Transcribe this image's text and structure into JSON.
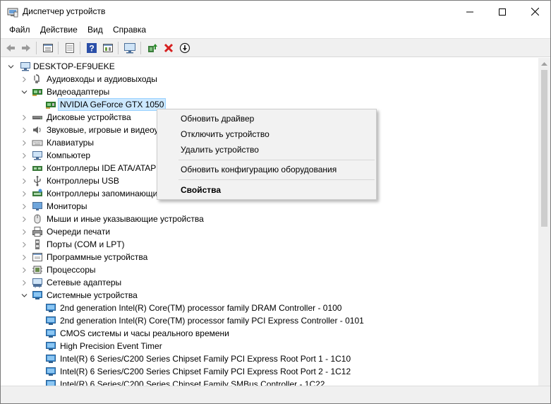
{
  "window": {
    "title": "Диспетчер устройств"
  },
  "menubar": [
    "Файл",
    "Действие",
    "Вид",
    "Справка"
  ],
  "toolbar": {
    "icons": [
      "back-icon",
      "forward-icon",
      "properties-icon",
      "tree-view-icon",
      "help-icon",
      "action-view-icon",
      "monitor-icon",
      "update-driver-icon",
      "remove-icon",
      "download-icon"
    ]
  },
  "tree": {
    "root": "DESKTOP-EF9UEKE",
    "items": [
      {
        "label": "Аудиовходы и аудиовыходы",
        "icon": "audio-io-icon",
        "state": "collapsed"
      },
      {
        "label": "Видеоадаптеры",
        "icon": "display-adapter-icon",
        "state": "expanded"
      },
      {
        "label": "NVIDIA GeForce GTX 1050",
        "icon": "gpu-icon",
        "child": true,
        "selected": true
      },
      {
        "label": "Дисковые устройства",
        "icon": "disk-icon",
        "state": "collapsed"
      },
      {
        "label": "Звуковые, игровые и видеоустройства",
        "icon": "sound-icon",
        "state": "collapsed"
      },
      {
        "label": "Клавиатуры",
        "icon": "keyboard-icon",
        "state": "collapsed"
      },
      {
        "label": "Компьютер",
        "icon": "computer-icon",
        "state": "collapsed"
      },
      {
        "label": "Контроллеры IDE ATA/ATAPI",
        "icon": "ide-controller-icon",
        "state": "collapsed"
      },
      {
        "label": "Контроллеры USB",
        "icon": "usb-icon",
        "state": "collapsed"
      },
      {
        "label": "Контроллеры запоминающих устройств",
        "icon": "storage-controller-icon",
        "state": "collapsed"
      },
      {
        "label": "Мониторы",
        "icon": "monitor-icon",
        "state": "collapsed"
      },
      {
        "label": "Мыши и иные указывающие устройства",
        "icon": "mouse-icon",
        "state": "collapsed"
      },
      {
        "label": "Очереди печати",
        "icon": "printer-icon",
        "state": "collapsed"
      },
      {
        "label": "Порты (COM и LPT)",
        "icon": "port-icon",
        "state": "collapsed"
      },
      {
        "label": "Программные устройства",
        "icon": "software-device-icon",
        "state": "collapsed"
      },
      {
        "label": "Процессоры",
        "icon": "processor-icon",
        "state": "collapsed"
      },
      {
        "label": "Сетевые адаптеры",
        "icon": "network-adapter-icon",
        "state": "collapsed"
      },
      {
        "label": "Системные устройства",
        "icon": "system-device-icon",
        "state": "expanded"
      },
      {
        "label": "2nd generation Intel(R) Core(TM) processor family DRAM Controller - 0100",
        "icon": "system-device-icon",
        "child": true
      },
      {
        "label": "2nd generation Intel(R) Core(TM) processor family PCI Express Controller - 0101",
        "icon": "system-device-icon",
        "child": true
      },
      {
        "label": "CMOS системы и часы реального времени",
        "icon": "system-device-icon",
        "child": true
      },
      {
        "label": "High Precision Event Timer",
        "icon": "system-device-icon",
        "child": true
      },
      {
        "label": "Intel(R) 6 Series/C200 Series Chipset Family PCI Express Root Port 1 - 1C10",
        "icon": "system-device-icon",
        "child": true
      },
      {
        "label": "Intel(R) 6 Series/C200 Series Chipset Family PCI Express Root Port 2 - 1C12",
        "icon": "system-device-icon",
        "child": true
      },
      {
        "label": "Intel(R) 6 Series/C200 Series Chipset Family SMBus Controller - 1C22",
        "icon": "system-device-icon",
        "child": true
      }
    ]
  },
  "context_menu": {
    "items": [
      {
        "label": "Обновить драйвер"
      },
      {
        "label": "Отключить устройство"
      },
      {
        "label": "Удалить устройство"
      },
      {
        "label": "Обновить конфигурацию оборудования"
      },
      {
        "label": "Свойства",
        "bold": true
      }
    ]
  }
}
